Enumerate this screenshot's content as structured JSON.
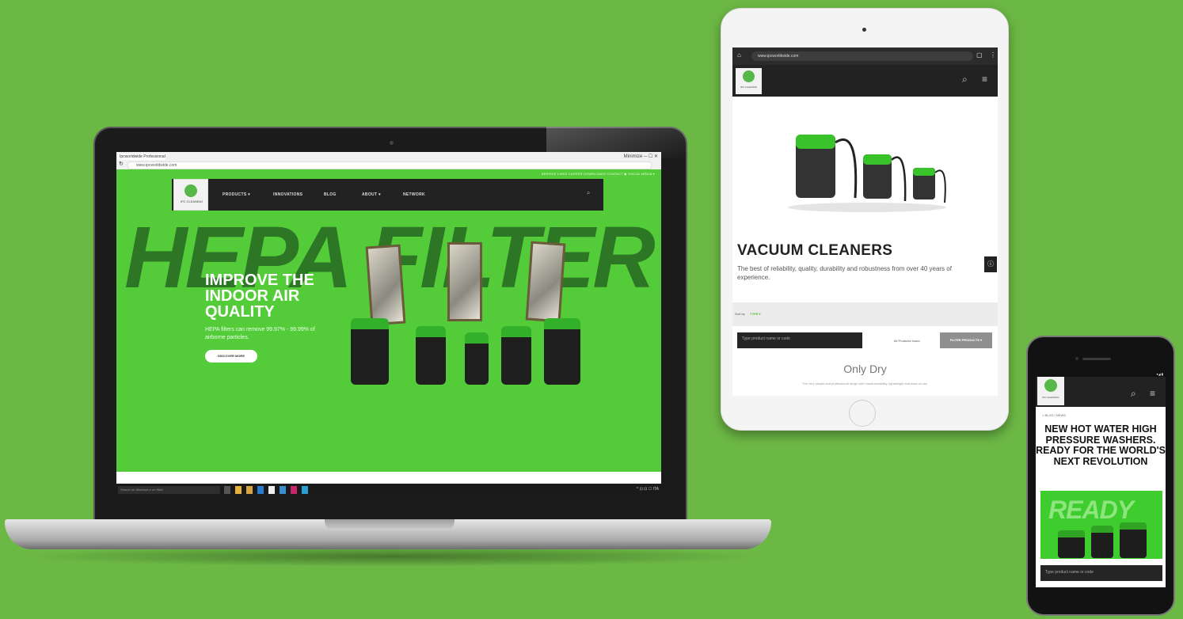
{
  "laptop": {
    "browser": {
      "tab_title": "Ipcworldwide Professional ×",
      "url": "www.ipcworldwide.com",
      "window_controls": "Minimize  ─  ☐  ✕"
    },
    "site": {
      "utility_links": "SERVICE LINKS   CAREER   DOWNLOADS   CONTACT   ◉ SOCIAL MEDIA ▾",
      "logo_text": "IPC CLEANING",
      "nav": [
        "PRODUCTS ▾",
        "INNOVATIONS",
        "BLOG",
        "ABOUT ▾",
        "NETWORK"
      ],
      "hero_bg_text": "HEPA FILTER",
      "hero_title": "IMPROVE THE INDOOR AIR QUALITY",
      "hero_subtitle": "HEPA filters can remove 99.97% - 99.99% of airborne particles.",
      "hero_button": "DISCOVER MORE"
    },
    "taskbar": {
      "search_placeholder": "Search on Windows e on Web",
      "tray": "^ ⊡ ⊡ ☐ ITA"
    }
  },
  "tablet": {
    "url": "www.ipcworldwide.com",
    "logo_text": "IPC CLEANING",
    "title": "VACUUM CLEANERS",
    "description": "The best of reliability, quality, durability and robustness from over 40 years of experience.",
    "sort_label": "Sort by",
    "sort_value": "TYPE ▾",
    "search_placeholder": "Type product name or code",
    "products_found": "84 Products found",
    "filter_button": "FILTER PRODUCTS ▾",
    "category_title": "Only Dry",
    "category_subtitle": "The very simple and professional range with maneuverability, lightweight and ease of use."
  },
  "phone": {
    "logo_text": "IPC CLEANING",
    "breadcrumb": "< BLOG / NEWS",
    "title": "NEW HOT WATER HIGH PRESSURE WASHERS. READY FOR THE WORLD'S NEXT REVOLUTION",
    "image_text": "READY",
    "search_placeholder": "Type product name or code"
  },
  "colors": {
    "background": "#6cb845",
    "brand_green": "#54cc3a",
    "dark_nav": "#222222"
  }
}
